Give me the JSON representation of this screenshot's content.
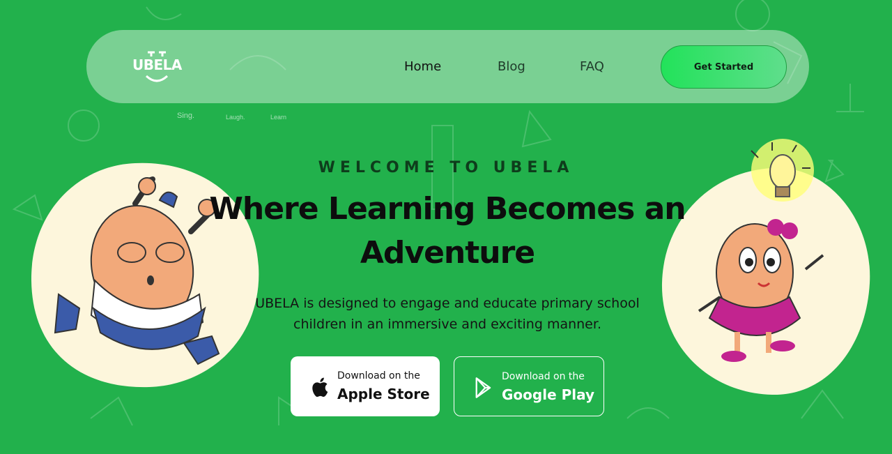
{
  "brand": {
    "logo_text": "UBELA",
    "taglines": [
      "Sing.",
      "Laugh.",
      "Learn"
    ]
  },
  "nav": {
    "items": [
      {
        "label": "Home"
      },
      {
        "label": "Blog"
      },
      {
        "label": "FAQ"
      }
    ],
    "cta_label": "Get Started"
  },
  "hero": {
    "eyebrow": "WELCOME TO UBELA",
    "title": "Where Learning Becomes an Adventure",
    "description": "UBELA is designed to engage and educate primary school children in an immersive and exciting manner."
  },
  "downloads": {
    "apple": {
      "small": "Download on the",
      "big": "Apple Store",
      "icon": "apple-icon"
    },
    "google": {
      "small": "Download on the",
      "big": "Google Play",
      "icon": "play-icon"
    }
  },
  "colors": {
    "background": "#22b14c",
    "cta": "#22e25a",
    "blob": "#fdf6dc"
  }
}
